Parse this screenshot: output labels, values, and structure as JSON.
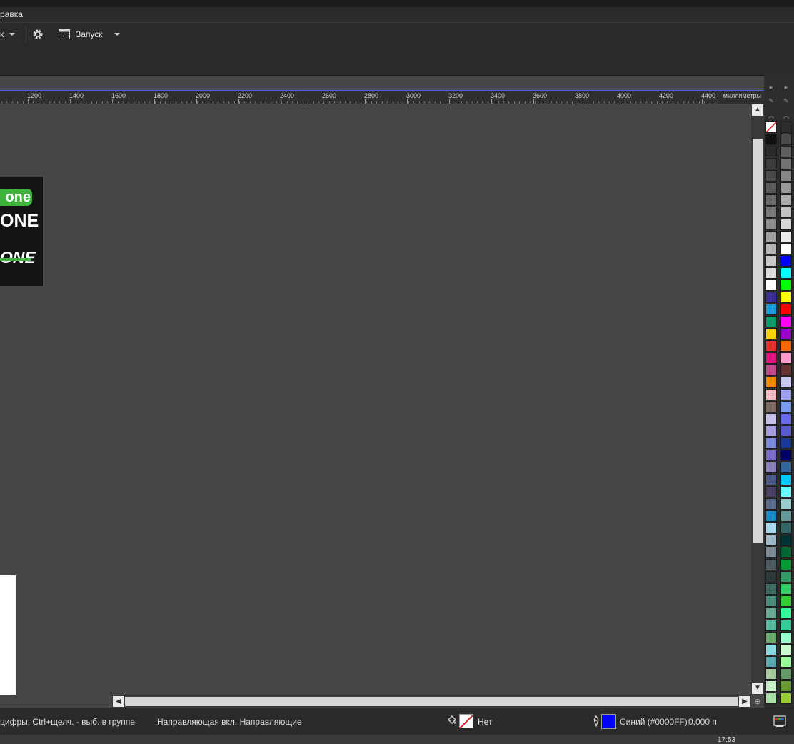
{
  "menubar": {
    "partial_item": "равка"
  },
  "toolbar": {
    "partial_item": "к",
    "launch_label": "Запуск"
  },
  "ruler": {
    "labels": [
      "1200",
      "1400",
      "1600",
      "1800",
      "2000",
      "2200",
      "2400",
      "2600",
      "2800",
      "3000",
      "3200",
      "3400",
      "3600",
      "3800",
      "4000",
      "4200",
      "4400"
    ],
    "unit": "миллиметры"
  },
  "canvas": {
    "logo": {
      "line1": "one",
      "line2": "ONE",
      "line3": "ONE"
    }
  },
  "status": {
    "hint": "цифры; Ctrl+щелч. - выб. в группе",
    "guides": "Направляющая вкл. Направляющие",
    "fill_label": "Нет",
    "outline_label": "Синий (#0000FF)",
    "outline_width": "0,000 п",
    "fill_color": "none",
    "outline_color": "#0000FF"
  },
  "taskbar": {
    "clock": "17:53"
  },
  "palette_left": [
    "none",
    "#111111",
    "#2b2b2b",
    "#3d3d3d",
    "#4a4a4a",
    "#5a5a5a",
    "#6a6a6a",
    "#7a7a7a",
    "#8c8c8c",
    "#a0a0a0",
    "#b4b4b4",
    "#c8c8c8",
    "#dcdcdc",
    "#ffffff",
    "#3a2f96",
    "#1a9ad6",
    "#0a9b6b",
    "#f5d20a",
    "#e3312d",
    "#e0147f",
    "#c04a8a",
    "#f08a00",
    "#f4b8c0",
    "#7d6a62",
    "#c8c0e8",
    "#a89ee0",
    "#7a88d8",
    "#7a6ac8",
    "#8a80b8",
    "#4a5a8a",
    "#4a4060",
    "#5a6a8a",
    "#1a8ac8",
    "#a8d8f0",
    "#a0b8c8",
    "#7a8a96",
    "#4a5a60",
    "#2e3a3a",
    "#3a6a60",
    "#4a8a78",
    "#6aa896",
    "#5ab8a0",
    "#6aa870",
    "#8ad8e0",
    "#5aa8b0",
    "#a8c8a0",
    "#c8f0c8",
    "#a8e0a8"
  ],
  "palette_right": [
    "#2e2e2e",
    "#4a4a4a",
    "#5e5e5e",
    "#727272",
    "#868686",
    "#9a9a9a",
    "#aeaeae",
    "#c2c2c2",
    "#d6d6d6",
    "#eaeaea",
    "#ffffff",
    "#0000ff",
    "#00ffff",
    "#00ff00",
    "#ffff00",
    "#ff0000",
    "#ff00ff",
    "#9900cc",
    "#ff6600",
    "#ff99cc",
    "#663333",
    "#c8c8f0",
    "#a0a0f0",
    "#7a9af0",
    "#6a6aee",
    "#5a5ad0",
    "#1a3a9a",
    "#000066",
    "#336699",
    "#00ccff",
    "#66ffff",
    "#99cccc",
    "#669999",
    "#336666",
    "#003333",
    "#006633",
    "#009933",
    "#339966",
    "#33cc66",
    "#33cc33",
    "#33ff99",
    "#33cc99",
    "#99ffcc",
    "#ccffcc",
    "#99ff99",
    "#669966",
    "#669933",
    "#99cc33"
  ]
}
